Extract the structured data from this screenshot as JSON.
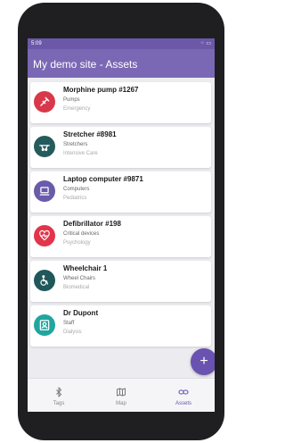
{
  "status_bar": {
    "time": "5:09",
    "indicators": "⁘ ▭"
  },
  "app_bar": {
    "title": "My demo site - Assets"
  },
  "assets": [
    {
      "name": "Morphine pump #1267",
      "category": "Pumps",
      "department": "Emergency",
      "icon": "syringe-icon",
      "color": "#d9384a"
    },
    {
      "name": "Stretcher #8981",
      "category": "Stretchers",
      "department": "Intensive Care",
      "icon": "stretcher-icon",
      "color": "#255b5b"
    },
    {
      "name": "Laptop computer #9871",
      "category": "Computers",
      "department": "Pediatrics",
      "icon": "laptop-icon",
      "color": "#6a5aaa"
    },
    {
      "name": "Defibrillator #198",
      "category": "Critical devices",
      "department": "Psychology",
      "icon": "heart-pulse-icon",
      "color": "#e2344a"
    },
    {
      "name": "Wheelchair 1",
      "category": "Wheel Chairs",
      "department": "Biomedical",
      "icon": "wheelchair-icon",
      "color": "#20575a"
    },
    {
      "name": "Dr Dupont",
      "category": "Staff",
      "department": "Dialysis",
      "icon": "person-icon",
      "color": "#21a59f"
    }
  ],
  "fab": {
    "label": "+"
  },
  "bottom_nav": [
    {
      "label": "Tags",
      "icon": "bluetooth-icon",
      "active": false
    },
    {
      "label": "Map",
      "icon": "map-icon",
      "active": false
    },
    {
      "label": "Assets",
      "icon": "link-icon",
      "active": true
    }
  ],
  "colors": {
    "primary": "#7b68b5",
    "status_bar": "#6b58a8",
    "accent": "#6a52b0"
  }
}
